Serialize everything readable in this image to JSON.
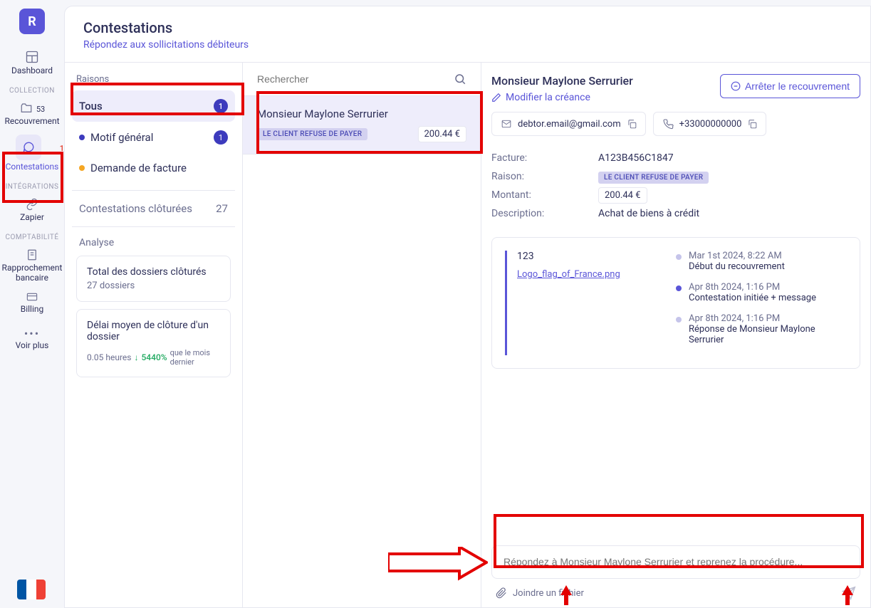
{
  "sidebar": {
    "logo": "R",
    "items": {
      "dashboard": "Dashboard",
      "collection_label": "COLLECTION",
      "recouvrement": {
        "label": "Recouvrement",
        "badge": "53"
      },
      "contestations": {
        "label": "Contestations",
        "badge": "1"
      },
      "integrations_label": "INTÉGRATIONS",
      "zapier": "Zapier",
      "compta_label": "COMPTABILITÉ",
      "rapprochement": "Rapprochement bancaire",
      "billing": "Billing",
      "more": "Voir plus"
    }
  },
  "header": {
    "title": "Contestations",
    "subtitle": "Répondez aux sollicitations débiteurs"
  },
  "reasons": {
    "label": "Raisons",
    "all": {
      "label": "Tous",
      "count": "1"
    },
    "general": {
      "label": "Motif général",
      "count": "1",
      "color": "#3d3bbd"
    },
    "invoice": {
      "label": "Demande de facture",
      "color": "#f5a623"
    },
    "closed": {
      "label": "Contestations clôturées",
      "count": "27"
    }
  },
  "analysis": {
    "label": "Analyse",
    "card1": {
      "title": "Total des dossiers clôturés",
      "sub": "27 dossiers"
    },
    "card2": {
      "title": "Délai moyen de clôture d'un dossier",
      "hours": "0.05 heures",
      "pct": "5440%",
      "note": "que le mois dernier"
    }
  },
  "search": {
    "placeholder": "Rechercher"
  },
  "list": {
    "item": {
      "name": "Monsieur Maylone Serrurier",
      "tag": "LE CLIENT REFUSE DE PAYER",
      "amount": "200.44 €"
    }
  },
  "detail": {
    "name": "Monsieur Maylone Serrurier",
    "modify": "Modifier la créance",
    "stop": "Arrêter le recouvrement",
    "email": "debtor.email@gmail.com",
    "phone": "+33000000000",
    "invoice_label": "Facture:",
    "invoice": "A123B456C1847",
    "reason_label": "Raison:",
    "reason_tag": "LE CLIENT REFUSE DE PAYER",
    "amount_label": "Montant:",
    "amount": "200.44 €",
    "desc_label": "Description:",
    "desc": "Achat de biens à crédit",
    "timeline": {
      "msg": "123",
      "file": "Logo_flag_of_France.png",
      "events": [
        {
          "date": "Mar 1st 2024, 8:22 AM",
          "text": "Début du recouvrement"
        },
        {
          "date": "Apr 8th 2024, 1:16 PM",
          "text": "Contestation initiée + message"
        },
        {
          "date": "Apr 8th 2024, 1:16 PM",
          "text": "Réponse de Monsieur Maylone Serrurier"
        }
      ]
    },
    "reply_placeholder": "Répondez à Monsieur Maylone Serrurier et reprenez la procédure...",
    "attach": "Joindre un fichier"
  }
}
